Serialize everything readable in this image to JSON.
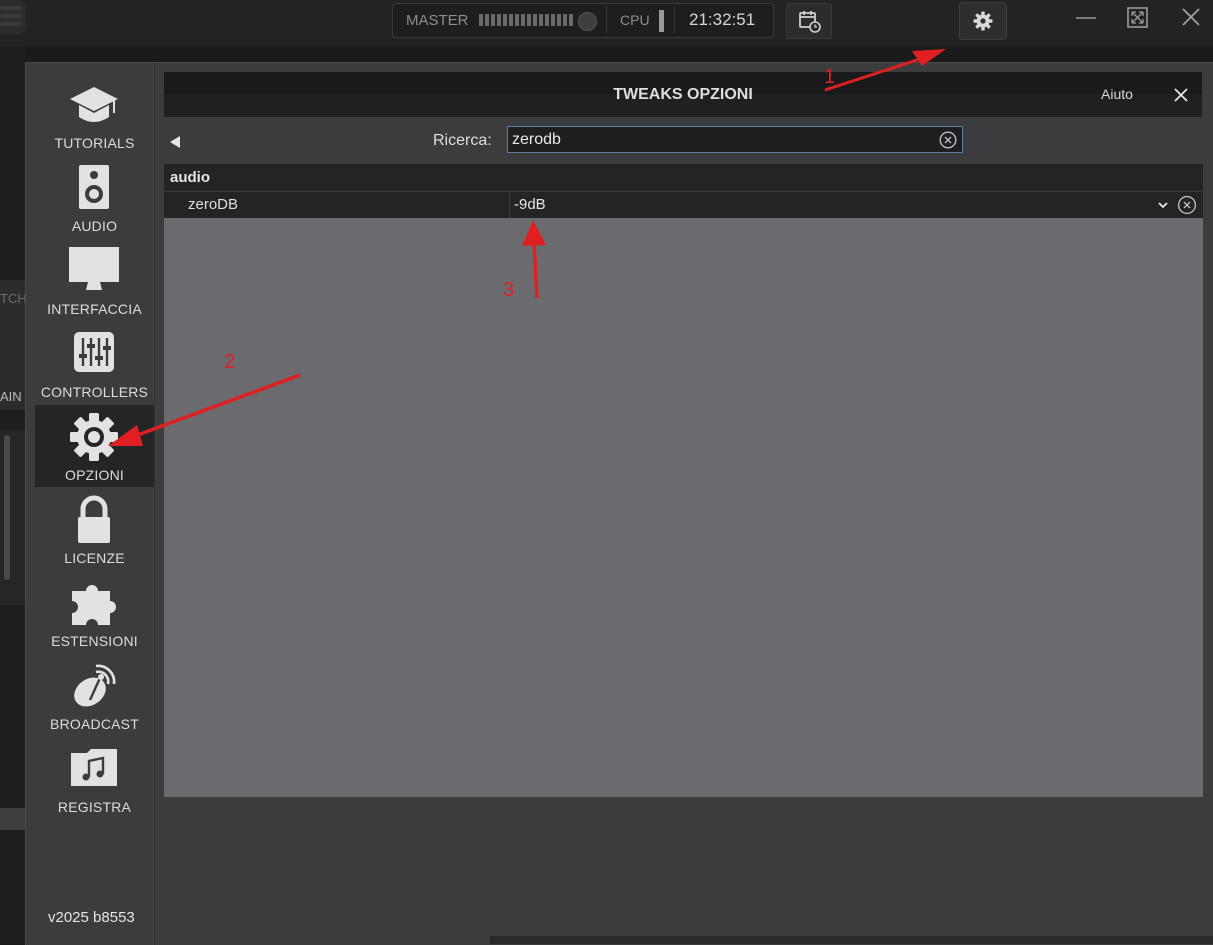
{
  "topbar": {
    "master_label": "MASTER",
    "cpu_label": "CPU",
    "clock": "21:32:51",
    "calendar_icon": "calendar-clock-icon",
    "settings_icon": "gear-icon",
    "window_controls": [
      "minimize-icon",
      "maximize-icon",
      "close-icon"
    ]
  },
  "background_deck": {
    "pitch_fragment": "TCH",
    "gain_fragment": "AIN"
  },
  "sidebar": {
    "items": [
      {
        "label": "TUTORIALS",
        "icon": "graduation-cap-icon"
      },
      {
        "label": "AUDIO",
        "icon": "speaker-icon"
      },
      {
        "label": "INTERFACCIA",
        "icon": "monitor-icon"
      },
      {
        "label": "CONTROLLERS",
        "icon": "sliders-icon"
      },
      {
        "label": "OPZIONI",
        "icon": "gear-icon",
        "active": true
      },
      {
        "label": "LICENZE",
        "icon": "lock-icon"
      },
      {
        "label": "ESTENSIONI",
        "icon": "puzzle-icon"
      },
      {
        "label": "BROADCAST",
        "icon": "satellite-dish-icon"
      },
      {
        "label": "REGISTRA",
        "icon": "music-folder-icon"
      }
    ],
    "version": "v2025 b8553"
  },
  "dialog": {
    "title": "TWEAKS OPZIONI",
    "help_label": "Aiuto",
    "search_label": "Ricerca:",
    "search_value": "zerodb",
    "group": "audio",
    "setting_name": "zeroDB",
    "setting_value": "-9dB"
  },
  "annotations": [
    "1",
    "2",
    "3"
  ],
  "colors": {
    "annotation": "#e02020",
    "accent_border": "#5d7d99"
  }
}
